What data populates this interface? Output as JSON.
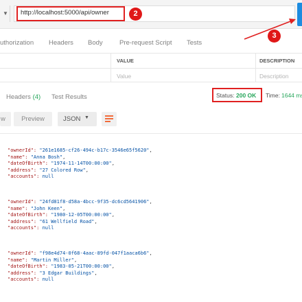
{
  "url_bar": {
    "url": "http://localhost:5000/api/owner",
    "annotation_2": "2",
    "annotation_3": "3"
  },
  "request_tabs": [
    "uthorization",
    "Headers",
    "Body",
    "Pre-request Script",
    "Tests"
  ],
  "params_table": {
    "columns": [
      "VALUE",
      "DESCRIPTION"
    ],
    "placeholders": [
      "Value",
      "Description"
    ]
  },
  "response": {
    "tab_headers": "Headers",
    "tab_headers_count": "(4)",
    "tab_test_results": "Test Results",
    "status_label": "Status:",
    "status_value": "200 OK",
    "time_label": "Time:",
    "time_value": "1644 ms"
  },
  "view": {
    "pretty_partial": "w",
    "preview": "Preview",
    "format": "JSON"
  },
  "records": [
    {
      "ownerId": "\"261e1685-cf26-494c-b17c-3546e65f5620\"",
      "name": "\"Anna Bosh\"",
      "dateOfBirth": "\"1974-11-14T00:00:00\"",
      "address": "\"27 Colored Row\"",
      "accounts": "null"
    },
    {
      "ownerId": "\"24fd81f8-d58a-4bcc-9f35-dc6cd5641906\"",
      "name": "\"John Keen\"",
      "dateOfBirth": "\"1980-12-05T00:00:00\"",
      "address": "\"61 Wellfield Road\"",
      "accounts": "null"
    },
    {
      "ownerId": "\"f98e4d74-0f68-4aac-89fd-047f1aaca6b6\"",
      "name": "\"Martin Miller\"",
      "dateOfBirth": "\"1983-05-21T00:00:00\"",
      "address": "\"3 Edgar Buildings\"",
      "accounts": "null"
    }
  ],
  "json_keys": {
    "ownerId": "\"ownerId\": ",
    "name": "\"name\": ",
    "dateOfBirth": "\"dateOfBirth\": ",
    "address": "\"address\": ",
    "accounts": "\"accounts\": "
  },
  "colors": {
    "accent_red": "#e02020",
    "status_green": "#26a65b",
    "send_blue": "#1d8ce0",
    "wrap_orange": "#f26b3a"
  }
}
